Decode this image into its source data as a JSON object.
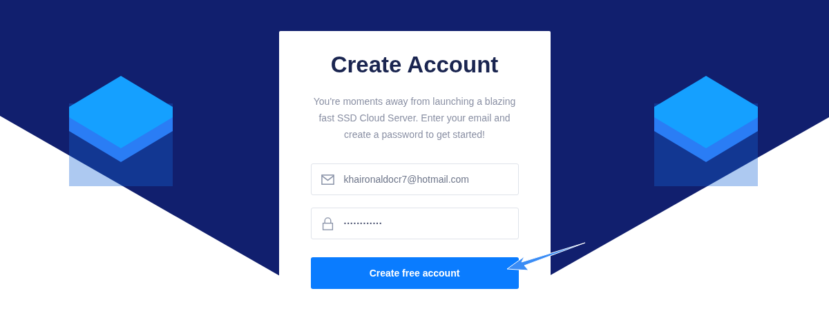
{
  "card": {
    "title": "Create Account",
    "description": "You're moments away from launching a blazing fast SSD Cloud Server. Enter your email and create a password to get started!",
    "fields": [
      {
        "kind": "email",
        "value": "khaironaldocr7@hotmail.com"
      },
      {
        "kind": "password",
        "value": "············"
      }
    ],
    "button": {
      "label": "Create free account"
    }
  }
}
